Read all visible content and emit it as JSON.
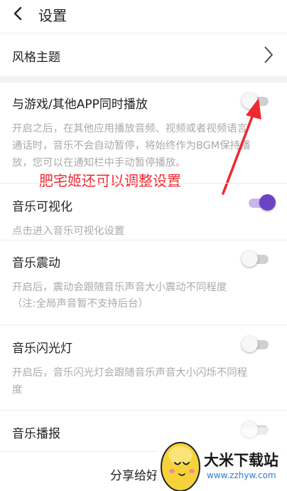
{
  "header": {
    "title": "设置",
    "back_icon": "chevron-left-icon"
  },
  "theme_row": {
    "label": "风格主题",
    "icon": "chevron-right-icon"
  },
  "game_play_row": {
    "label": "与游戏/其他APP同时播放",
    "enabled": false,
    "description": [
      "开启之后，在其他应用播放音频、视频或者视频语言",
      "通话时，音乐不会自动暂停，将始终作为BGM保持播",
      "放，您可以在通知栏中手动暂停播放。"
    ]
  },
  "annotation": {
    "text": "肥宅姬还可以调整设置",
    "color": "#f0282e"
  },
  "visualize_row": {
    "label": "音乐可视化",
    "enabled": true,
    "description": "点击进入音乐可视化设置"
  },
  "vibrate_row": {
    "label": "音乐震动",
    "enabled": false,
    "description": [
      "开启后，震动会跟随音乐声音大小震动不同程度",
      "（注:全局声音暂不支持后台）"
    ]
  },
  "flash_row": {
    "label": "音乐闪光灯",
    "enabled": false,
    "description": [
      "开启后，音乐闪光灯会跟随音乐声音大小闪烁不同程",
      "度"
    ]
  },
  "announce_row": {
    "label": "音乐播报",
    "enabled": false
  },
  "share_row": {
    "label": "分享给好"
  },
  "watermark": {
    "name": "大米下载站",
    "url": "www.zzhyw.com"
  },
  "colors": {
    "accent": "#6b44c6",
    "toggle_off": "#d0d0d0",
    "annotation": "#f0282e"
  }
}
